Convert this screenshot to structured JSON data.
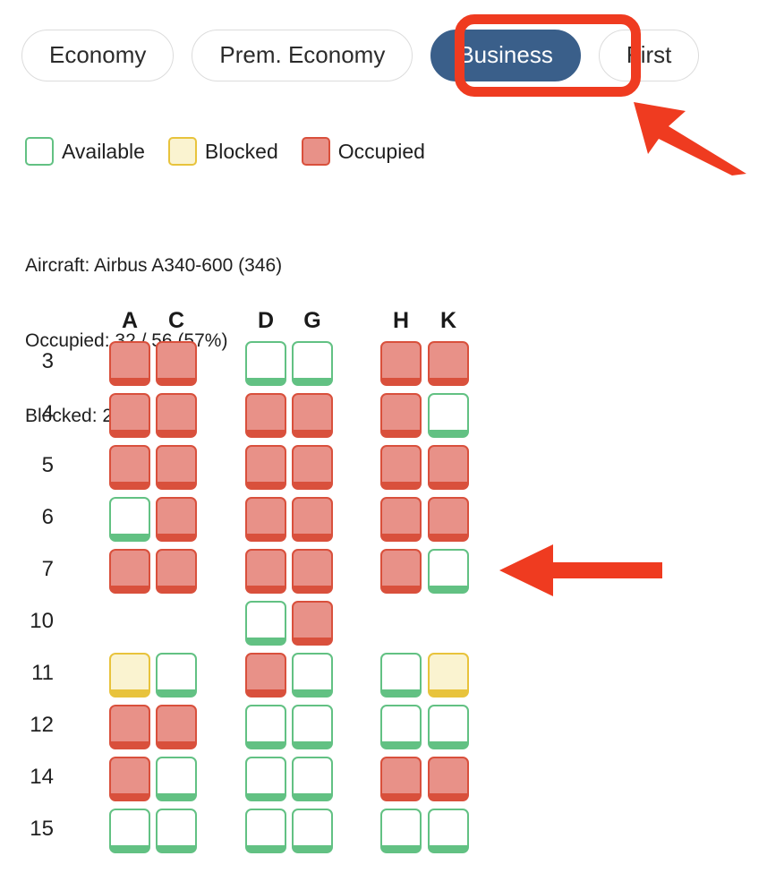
{
  "colors": {
    "selected_tab_bg": "#3a5f8a",
    "annotation_red": "#ef3b20",
    "available_border": "#62c183",
    "blocked_border": "#e8c33c",
    "blocked_fill": "#faf3d0",
    "occupied_border": "#d9503c",
    "occupied_fill": "#e89188"
  },
  "tabs": [
    {
      "label": "Economy",
      "selected": false
    },
    {
      "label": "Prem. Economy",
      "selected": false
    },
    {
      "label": "Business",
      "selected": true
    },
    {
      "label": "First",
      "selected": false
    }
  ],
  "legend": [
    {
      "label": "Available",
      "state": "available"
    },
    {
      "label": "Blocked",
      "state": "blocked"
    },
    {
      "label": "Occupied",
      "state": "occupied"
    }
  ],
  "info": {
    "aircraft": "Aircraft: Airbus A340-600 (346)",
    "occupied": "Occupied: 32 / 56 (57%)",
    "blocked": "Blocked: 2 / 56"
  },
  "seatmap": {
    "columns": [
      "A",
      "C",
      "D",
      "G",
      "H",
      "K"
    ],
    "rows": [
      {
        "label": "3",
        "seats": [
          "occupied",
          "occupied",
          "available",
          "available",
          "occupied",
          "occupied"
        ]
      },
      {
        "label": "4",
        "seats": [
          "occupied",
          "occupied",
          "occupied",
          "occupied",
          "occupied",
          "available"
        ]
      },
      {
        "label": "5",
        "seats": [
          "occupied",
          "occupied",
          "occupied",
          "occupied",
          "occupied",
          "occupied"
        ]
      },
      {
        "label": "6",
        "seats": [
          "available",
          "occupied",
          "occupied",
          "occupied",
          "occupied",
          "occupied"
        ]
      },
      {
        "label": "7",
        "seats": [
          "occupied",
          "occupied",
          "occupied",
          "occupied",
          "occupied",
          "available"
        ]
      },
      {
        "label": "10",
        "seats": [
          "empty",
          "empty",
          "available",
          "occupied",
          "empty",
          "empty"
        ]
      },
      {
        "label": "11",
        "seats": [
          "blocked",
          "available",
          "occupied",
          "available",
          "available",
          "blocked"
        ]
      },
      {
        "label": "12",
        "seats": [
          "occupied",
          "occupied",
          "available",
          "available",
          "available",
          "available"
        ]
      },
      {
        "label": "14",
        "seats": [
          "occupied",
          "available",
          "available",
          "available",
          "occupied",
          "occupied"
        ]
      },
      {
        "label": "15",
        "seats": [
          "available",
          "available",
          "available",
          "available",
          "available",
          "available"
        ]
      }
    ]
  },
  "annotations": {
    "arrow_to_tab": "arrow-up-left",
    "arrow_to_row": "arrow-left",
    "highlight_box": "business-tab-highlight"
  }
}
